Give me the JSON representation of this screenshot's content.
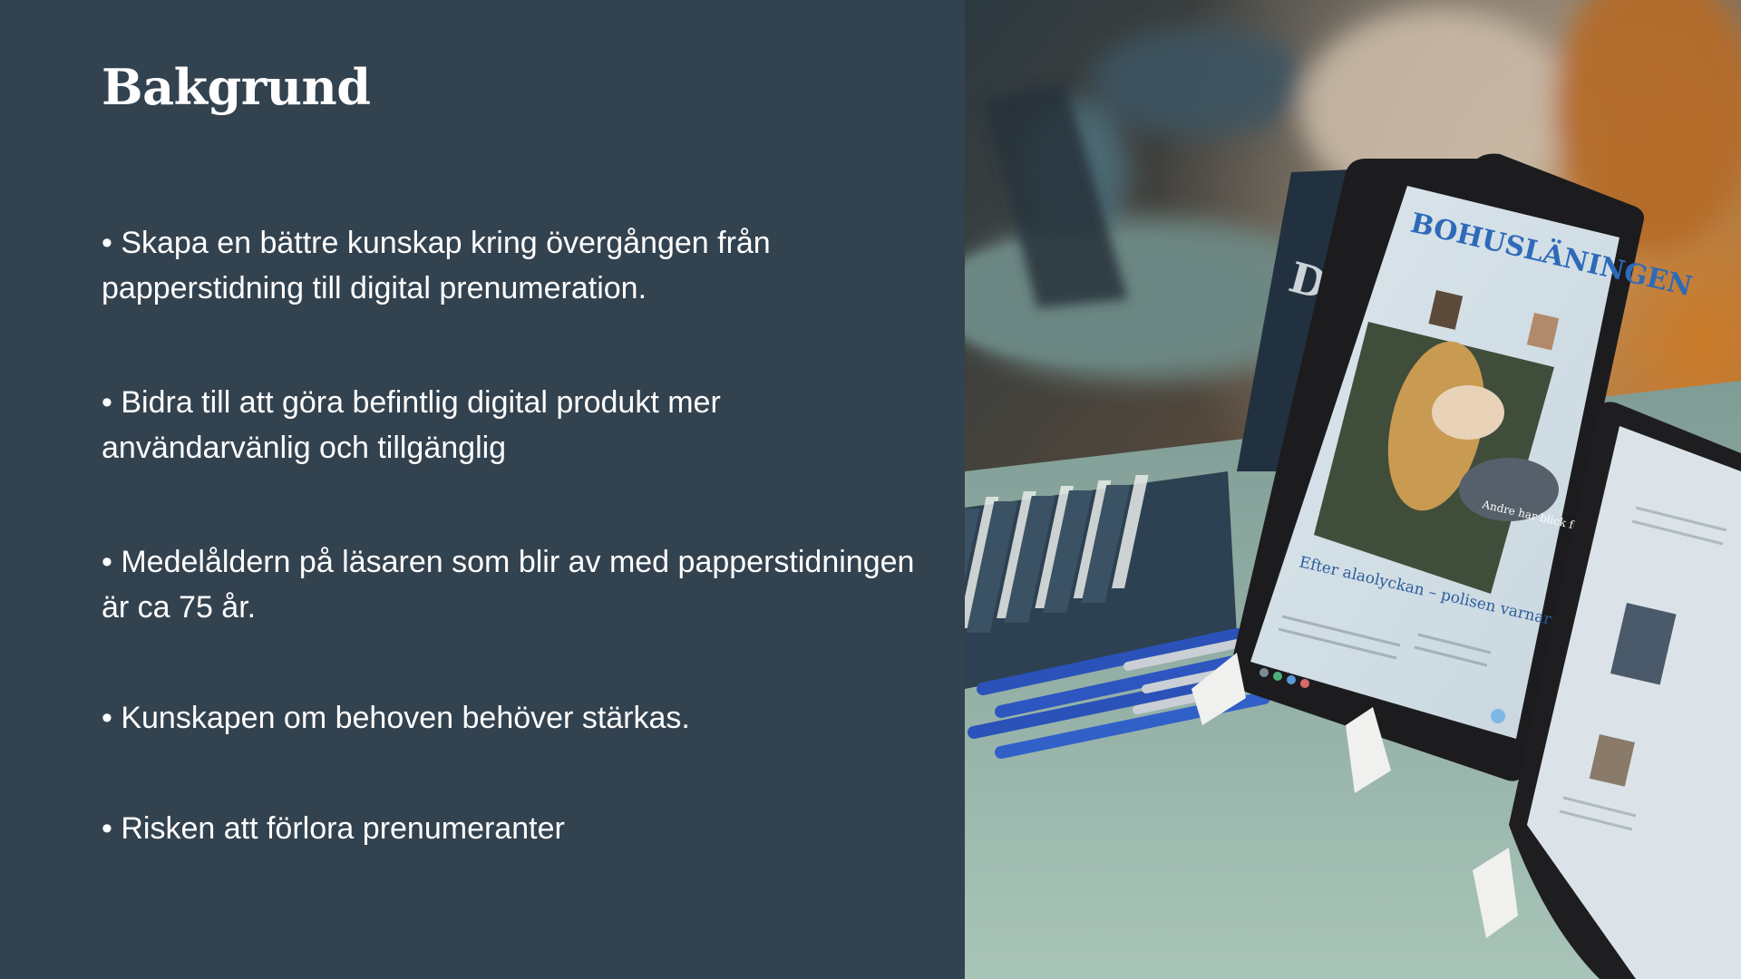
{
  "slide": {
    "title": "Bakgrund",
    "bullets": [
      "• Skapa en bättre kunskap kring övergången från papperstidning till digital prenumeration.",
      "• Bidra till att göra befintlig digital produkt mer användarvänlig och tillgänglig",
      "• Medelåldern på läsaren som blir av med papperstidningen är ca 75 år.",
      "• Kunskapen om behoven behöver stärkas.",
      "• Risken att förlora prenumeranter"
    ],
    "colors": {
      "panel_background": "#33424f",
      "text": "#ffffff",
      "table_surface": "#9fb8ad",
      "tablet_frame": "#1c1c1e",
      "pen_blue": "#2a52b8"
    }
  },
  "photo": {
    "brochure_text": "Digi-vad",
    "tablet_masthead": "BOHUSLÄNINGEN",
    "tablet_headline": "Efter alaolyckan – polisen varnar för älgar på vägarna",
    "tablet_caption": "Andre har blick för snygga bilar"
  }
}
